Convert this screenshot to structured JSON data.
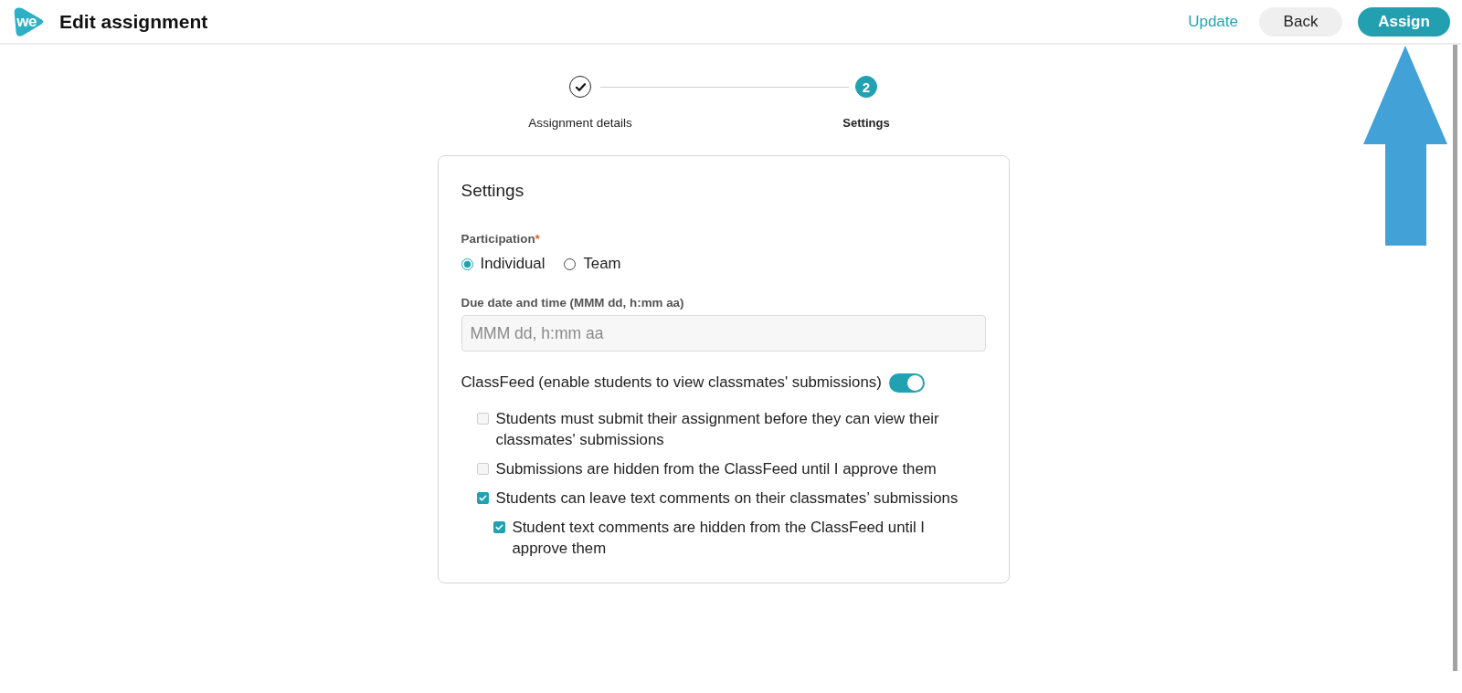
{
  "header": {
    "logo": "we",
    "title": "Edit assignment",
    "actions": [
      {
        "label": "Update",
        "kind": "link"
      },
      {
        "label": "Back",
        "kind": "secondary"
      },
      {
        "label": "Assign",
        "kind": "primary"
      }
    ]
  },
  "stepper": {
    "steps": [
      {
        "label": "Assignment details",
        "completed": true,
        "active": false
      },
      {
        "label": "Settings",
        "completed": false,
        "active": true,
        "number": "2"
      }
    ]
  },
  "settings": {
    "title": "Settings",
    "participation": {
      "label": "Participation",
      "required_mark": "*",
      "options": [
        {
          "label": "Individual",
          "selected": true
        },
        {
          "label": "Team",
          "selected": false
        }
      ]
    },
    "due_date": {
      "label": "Due date and time (MMM dd, h:mm aa)",
      "placeholder": "MMM dd, h:mm aa"
    },
    "classfeed": {
      "label": "ClassFeed (enable students to view classmates' submissions)",
      "on": true,
      "options": [
        {
          "label": "Students must submit their assignment before they can view their classmates' submissions",
          "checked": false
        },
        {
          "label": "Submissions are hidden from the ClassFeed until I approve them",
          "checked": false
        },
        {
          "label": "Students can leave text comments on their classmates’ submissions",
          "checked": true,
          "children": [
            {
              "label": "Student text comments are hidden from the ClassFeed until I approve them",
              "checked": true
            }
          ]
        }
      ]
    }
  },
  "annotations": [
    {
      "kind": "arrow"
    }
  ]
}
